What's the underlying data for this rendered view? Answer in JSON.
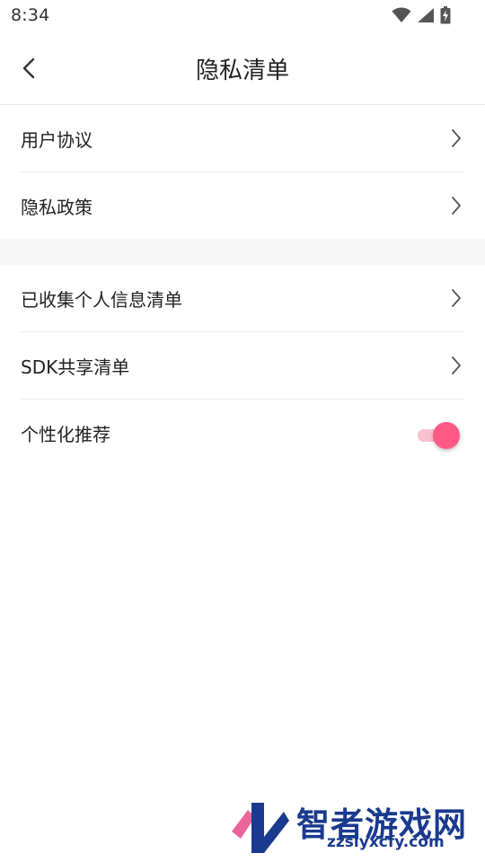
{
  "status_bar": {
    "time": "8:34",
    "icons": [
      "wifi-icon",
      "cellular-signal-icon",
      "battery-charging-icon"
    ]
  },
  "header": {
    "title": "隐私清单",
    "back_icon": "chevron-left-icon"
  },
  "section_1": {
    "items": [
      {
        "label": "用户协议"
      },
      {
        "label": "隐私政策"
      }
    ]
  },
  "section_2": {
    "items": [
      {
        "label": "已收集个人信息清单"
      },
      {
        "label": "SDK共享清单"
      }
    ],
    "toggle_item": {
      "label": "个性化推荐",
      "enabled": true
    }
  },
  "watermark": {
    "name": "智者游戏网",
    "url": "zzslyxcfy.com"
  },
  "colors": {
    "accent": "#ff5a85",
    "toggle_track": "#f9c1cf",
    "divider": "#ececec",
    "section_gap": "#f7f7f7"
  }
}
